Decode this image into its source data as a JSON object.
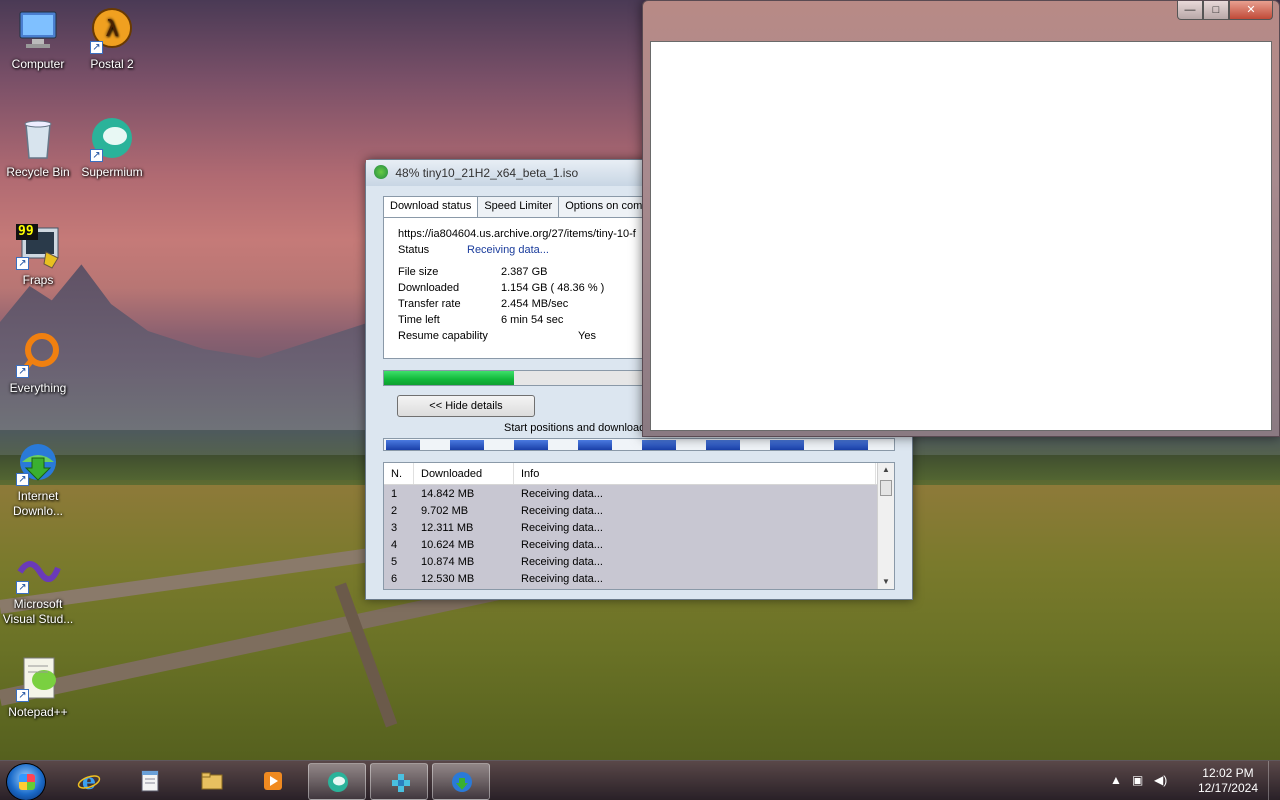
{
  "desktop": {
    "icons": [
      {
        "label": "Computer",
        "icon": "computer-icon"
      },
      {
        "label": "Postal 2",
        "icon": "postal2-icon"
      },
      {
        "label": "Recycle Bin",
        "icon": "recycle-bin-icon"
      },
      {
        "label": "Supermium",
        "icon": "supermium-icon"
      },
      {
        "label": "Fraps",
        "icon": "fraps-icon",
        "badge": "99"
      },
      {
        "label": "Everything",
        "icon": "everything-icon"
      },
      {
        "label": "Internet Downlo...",
        "line1": "Internet",
        "line2": "Downlo...",
        "icon": "idm-icon"
      },
      {
        "label": "Microsoft Visual Stud...",
        "line1": "Microsoft",
        "line2": "Visual Stud...",
        "icon": "visual-studio-icon"
      },
      {
        "label": "Notepad++",
        "icon": "notepadpp-icon"
      }
    ]
  },
  "idm_window": {
    "title": "48% tiny10_21H2_x64_beta_1.iso",
    "tabs": [
      "Download status",
      "Speed Limiter",
      "Options on compl"
    ],
    "url": "https://ia804604.us.archive.org/27/items/tiny-10-f",
    "status_label": "Status",
    "status_value": "Receiving data...",
    "file_size_label": "File size",
    "file_size": "2.387  GB",
    "downloaded_label": "Downloaded",
    "downloaded": "1.154  GB  ( 48.36 % )",
    "transfer_rate_label": "Transfer rate",
    "transfer_rate": "2.454  MB/sec",
    "time_left_label": "Time left",
    "time_left": "6 min 54 sec",
    "resume_label": "Resume capability",
    "resume_value": "Yes",
    "progress_percent": 48.36,
    "hide_details_button": "<< Hide details",
    "segments_label": "Start positions and download",
    "connections": {
      "columns": [
        "N.",
        "Downloaded",
        "Info"
      ],
      "rows": [
        {
          "n": "1",
          "downloaded": "14.842  MB",
          "info": "Receiving data..."
        },
        {
          "n": "2",
          "downloaded": "9.702  MB",
          "info": "Receiving data..."
        },
        {
          "n": "3",
          "downloaded": "12.311  MB",
          "info": "Receiving data..."
        },
        {
          "n": "4",
          "downloaded": "10.624  MB",
          "info": "Receiving data..."
        },
        {
          "n": "5",
          "downloaded": "10.874  MB",
          "info": "Receiving data..."
        },
        {
          "n": "6",
          "downloaded": "12.530  MB",
          "info": "Receiving data..."
        }
      ]
    }
  },
  "blank_window": {
    "minimize_glyph": "—",
    "maximize_glyph": "□",
    "close_glyph": "✕"
  },
  "taskbar": {
    "pinned": [
      {
        "name": "internet-explorer-icon"
      },
      {
        "name": "notepad-icon"
      },
      {
        "name": "file-explorer-icon"
      },
      {
        "name": "media-player-icon"
      },
      {
        "name": "supermium-icon",
        "active": true
      },
      {
        "name": "app-icon",
        "active": true
      },
      {
        "name": "idm-icon",
        "active": true
      }
    ],
    "tray": {
      "time": "12:02 PM",
      "date": "12/17/2024"
    }
  }
}
